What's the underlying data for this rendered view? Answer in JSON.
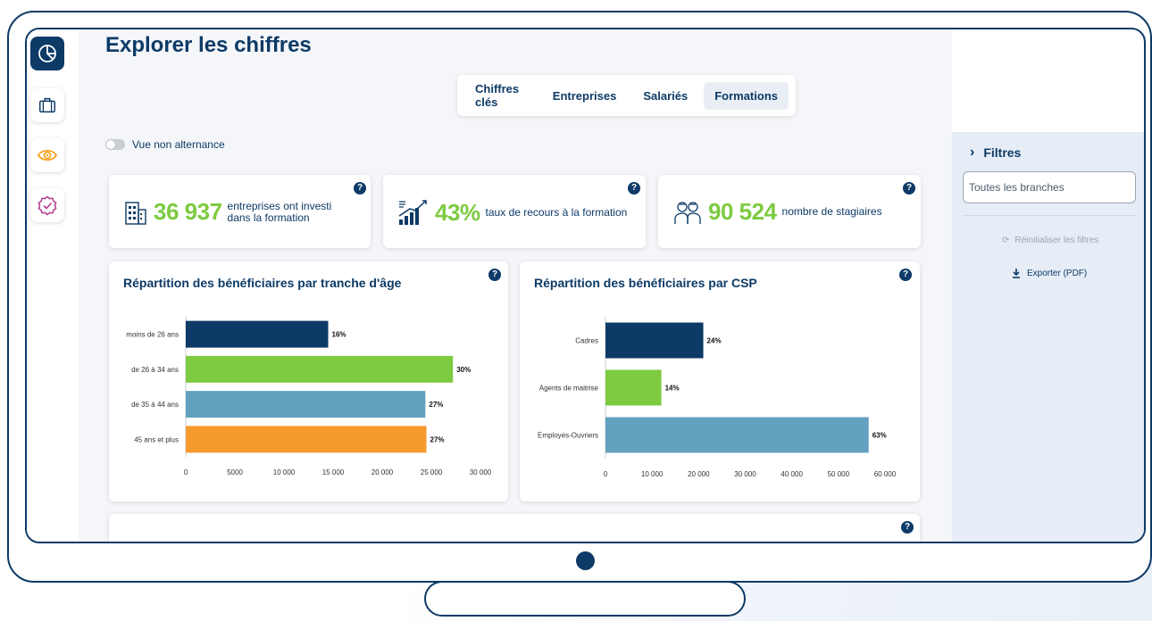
{
  "page": {
    "title": "Explorer les chiffres"
  },
  "tabs": [
    {
      "label": "Chiffres clés",
      "active": false
    },
    {
      "label": "Entreprises",
      "active": false
    },
    {
      "label": "Salariés",
      "active": false
    },
    {
      "label": "Formations",
      "active": true
    }
  ],
  "toggle": {
    "label": "Vue non alternance",
    "on": false
  },
  "kpis": [
    {
      "value": "36 937",
      "label_line1": "entreprises ont investi",
      "label_line2": "dans la formation",
      "icon": "building-icon"
    },
    {
      "value": "43%",
      "label_line1": "taux de recours à la formation",
      "label_line2": "",
      "icon": "growth-chart-icon"
    },
    {
      "value": "90 524",
      "label_line1": "nombre de stagiaires",
      "label_line2": "",
      "icon": "trainees-icon"
    }
  ],
  "help_symbol": "?",
  "filters": {
    "title": "Filtres",
    "select_value": "Toutes les branches",
    "reset_label": "Réinitialiser les filtres",
    "export_label": "Exporter (PDF)"
  },
  "colors": {
    "navy": "#0d3a66",
    "green": "#7dcb41",
    "teal": "#63a1be",
    "orange": "#f79a2e"
  },
  "chart_data": [
    {
      "type": "bar",
      "orientation": "horizontal",
      "title": "Répartition des bénéficiaires par tranche d'âge",
      "categories": [
        "moins de 26 ans",
        "de 26 à 34 ans",
        "de 35 à 44 ans",
        "45 ans et plus"
      ],
      "values": [
        14500,
        27200,
        24400,
        24500
      ],
      "data_labels": [
        "16%",
        "30%",
        "27%",
        "27%"
      ],
      "bar_colors": [
        "#0d3a66",
        "#7dcb41",
        "#63a1be",
        "#f79a2e"
      ],
      "xlim": [
        0,
        30000
      ],
      "x_ticks": [
        0,
        5000,
        10000,
        15000,
        20000,
        25000,
        30000
      ],
      "x_tick_labels": [
        "0",
        "5000",
        "10 000",
        "15 000",
        "20 000",
        "25 000",
        "30 000"
      ],
      "grid": false
    },
    {
      "type": "bar",
      "orientation": "horizontal",
      "title": "Répartition des bénéficiaires par CSP",
      "categories": [
        "Cadres",
        "Agents de maitrise",
        "Employés-Ouvriers"
      ],
      "values": [
        21000,
        12000,
        56500
      ],
      "data_labels": [
        "24%",
        "14%",
        "63%"
      ],
      "bar_colors": [
        "#0d3a66",
        "#7dcb41",
        "#63a1be"
      ],
      "xlim": [
        0,
        60000
      ],
      "x_ticks": [
        0,
        10000,
        20000,
        30000,
        40000,
        50000,
        60000
      ],
      "x_tick_labels": [
        "0",
        "10 000",
        "20 000",
        "30 000",
        "40 000",
        "50 000",
        "60 000"
      ],
      "grid": false
    }
  ]
}
